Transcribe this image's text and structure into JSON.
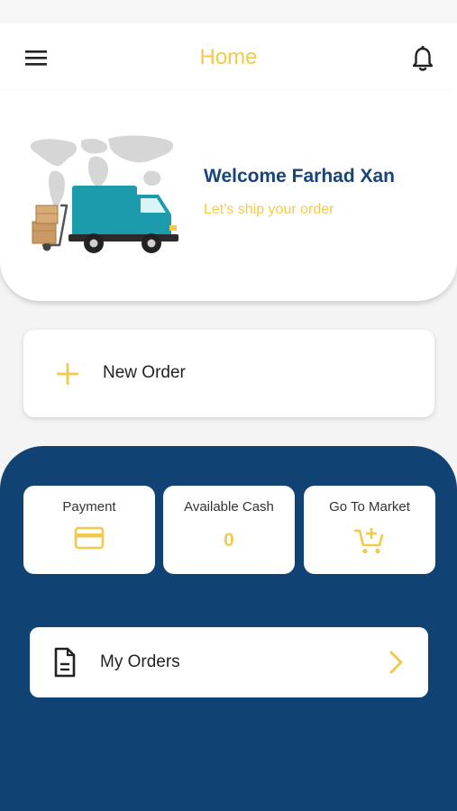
{
  "header": {
    "title": "Home",
    "menu_icon": "hamburger-menu-icon",
    "notification_icon": "bell-icon"
  },
  "welcome": {
    "title": "Welcome Farhad Xan",
    "subtitle": "Let's ship your order",
    "illustration": "delivery-truck-with-boxes-over-world-map"
  },
  "new_order": {
    "label": "New Order",
    "icon": "plus-icon"
  },
  "tiles": [
    {
      "label": "Payment",
      "icon": "credit-card-icon"
    },
    {
      "label": "Available Cash",
      "value": "0"
    },
    {
      "label": "Go To Market",
      "icon": "add-to-cart-icon"
    }
  ],
  "my_orders": {
    "label": "My Orders",
    "icon": "document-icon",
    "chevron": "chevron-right-icon"
  },
  "colors": {
    "accent_yellow": "#f2c94c",
    "navy": "#114274",
    "title_blue": "#17457a",
    "truck_teal": "#1b9bab"
  }
}
